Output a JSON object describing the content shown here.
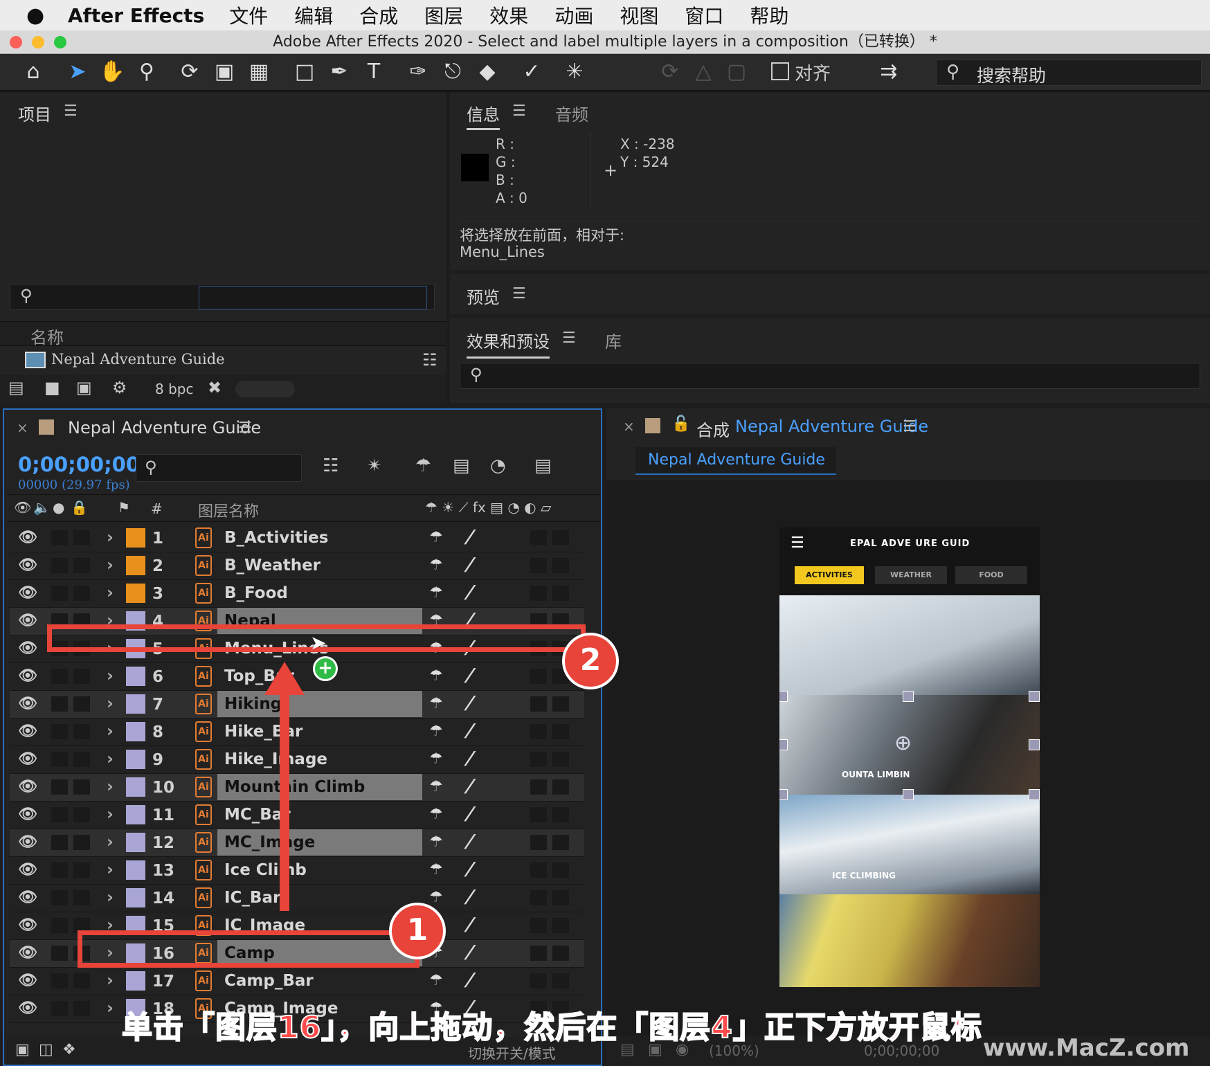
{
  "menubar": {
    "app": "After Effects",
    "items": [
      "文件",
      "编辑",
      "合成",
      "图层",
      "效果",
      "动画",
      "视图",
      "窗口",
      "帮助"
    ]
  },
  "window": {
    "title": "Adobe After Effects 2020 - Select and label multiple layers in a composition（已转换） *"
  },
  "toolbar": {
    "align_label": "对齐",
    "search_help": "搜索帮助"
  },
  "project": {
    "title": "项目",
    "col_name": "名称",
    "item": "Nepal Adventure Guide",
    "bpc": "8 bpc"
  },
  "info": {
    "tab_info": "信息",
    "tab_audio": "音频",
    "r": "R :",
    "g": "G :",
    "b": "B :",
    "a": "A :  0",
    "x": "X : -238",
    "y": "Y : 524",
    "msg1": "将选择放在前面，相对于:",
    "msg2": "Menu_Lines"
  },
  "preview": {
    "title": "预览"
  },
  "effects": {
    "tab": "效果和预设",
    "tab_lib": "库"
  },
  "timeline": {
    "comp_name": "Nepal Adventure Guide",
    "timecode": "0;00;00;00",
    "frames": "00000 (29.97 fps)",
    "col_num": "#",
    "col_layer": "图层名称",
    "footer": "切换开关/模式",
    "layers": [
      {
        "num": "1",
        "name": "B_Activities",
        "color": "#e8901c",
        "sel": false
      },
      {
        "num": "2",
        "name": "B_Weather",
        "color": "#e8901c",
        "sel": false
      },
      {
        "num": "3",
        "name": "B_Food",
        "color": "#e8901c",
        "sel": false
      },
      {
        "num": "4",
        "name": "Nepal",
        "color": "#a9a6d6",
        "sel": true
      },
      {
        "num": "5",
        "name": "Menu_Lines",
        "color": "#a9a6d6",
        "sel": false
      },
      {
        "num": "6",
        "name": "Top_Bar",
        "color": "#a9a6d6",
        "sel": false
      },
      {
        "num": "7",
        "name": "Hiking",
        "color": "#a9a6d6",
        "sel": true
      },
      {
        "num": "8",
        "name": "Hike_Bar",
        "color": "#a9a6d6",
        "sel": false
      },
      {
        "num": "9",
        "name": "Hike_Image",
        "color": "#a9a6d6",
        "sel": false
      },
      {
        "num": "10",
        "name": "Mountain Climb",
        "color": "#a9a6d6",
        "sel": true
      },
      {
        "num": "11",
        "name": "MC_Bar",
        "color": "#a9a6d6",
        "sel": false
      },
      {
        "num": "12",
        "name": "MC_Image",
        "color": "#a9a6d6",
        "sel": true
      },
      {
        "num": "13",
        "name": "Ice Climb",
        "color": "#a9a6d6",
        "sel": false
      },
      {
        "num": "14",
        "name": "IC_Bar",
        "color": "#a9a6d6",
        "sel": false
      },
      {
        "num": "15",
        "name": "IC_Image",
        "color": "#a9a6d6",
        "sel": false
      },
      {
        "num": "16",
        "name": "Camp",
        "color": "#a9a6d6",
        "sel": true
      },
      {
        "num": "17",
        "name": "Camp_Bar",
        "color": "#a9a6d6",
        "sel": false
      },
      {
        "num": "18",
        "name": "Camp_Image",
        "color": "#a9a6d6",
        "sel": false
      }
    ]
  },
  "comp": {
    "label": "合成",
    "name": "Nepal Adventure Guide",
    "tab": "Nepal Adventure Guide",
    "zoom": "(100%)",
    "timecode": "0;00;00;00"
  },
  "app_preview": {
    "header": "EPAL ADVE  URE GUID",
    "tabs": [
      "ACTIVITIES",
      "WEATHER",
      "FOOD"
    ],
    "s2": "OUNTA  LIMBIN",
    "s3": "ICE CLIMBING"
  },
  "annotations": {
    "step1": "1",
    "step2": "2",
    "caption": "单击「图层16」，向上拖动，然后在「图层4」正下方放开鼠标",
    "watermark": "www.MacZ.com"
  },
  "colors": {
    "accent_blue": "#3b9cff",
    "selection": "#7a7a7a",
    "annotation_red": "#e8443a",
    "tab_yellow": "#f2c81e"
  }
}
